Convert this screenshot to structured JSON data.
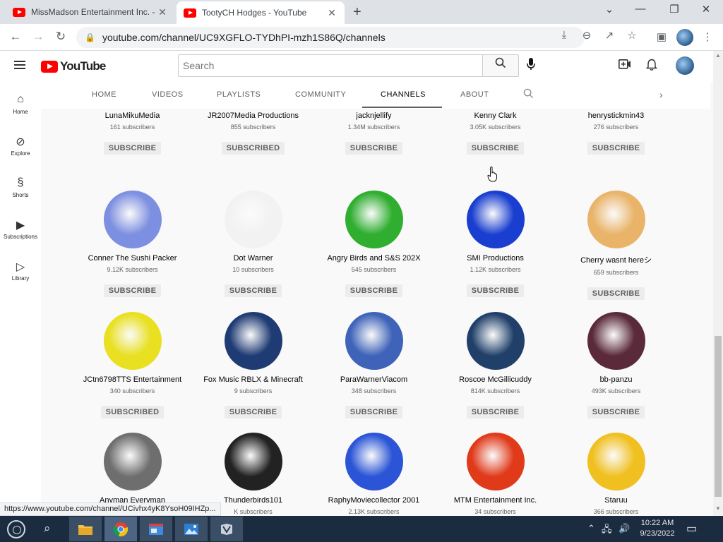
{
  "browser": {
    "tabs": [
      {
        "title": "MissMadson Entertainment Inc. -",
        "active": false
      },
      {
        "title": "TootyCH Hodges - YouTube",
        "active": true
      }
    ],
    "address": "youtube.com/channel/UC9XGFLO-TYDhPI-mzh1S86Q/channels"
  },
  "youtube": {
    "logo_text": "YouTube",
    "search_placeholder": "Search",
    "guide": [
      {
        "label": "Home",
        "icon": "home-icon"
      },
      {
        "label": "Explore",
        "icon": "compass-icon"
      },
      {
        "label": "Shorts",
        "icon": "shorts-icon"
      },
      {
        "label": "Subscriptions",
        "icon": "subscriptions-icon"
      },
      {
        "label": "Library",
        "icon": "library-icon"
      }
    ],
    "channel_tabs": [
      {
        "label": "HOME",
        "active": false
      },
      {
        "label": "VIDEOS",
        "active": false
      },
      {
        "label": "PLAYLISTS",
        "active": false
      },
      {
        "label": "COMMUNITY",
        "active": false
      },
      {
        "label": "CHANNELS",
        "active": true
      },
      {
        "label": "ABOUT",
        "active": false
      }
    ],
    "channels": [
      {
        "name": "LunaMikuMedia",
        "subs": "161 subscribers",
        "button": "SUBSCRIBE",
        "color": "#f7a8d8"
      },
      {
        "name": "JR2007Media Productions",
        "subs": "855 subscribers",
        "button": "SUBSCRIBED",
        "color": "#6a2cf0"
      },
      {
        "name": "jacknjellify",
        "subs": "1.34M subscribers",
        "button": "SUBSCRIBE",
        "color": "#f5c400"
      },
      {
        "name": "Kenny Clark",
        "subs": "3.05K subscribers",
        "button": "SUBSCRIBE",
        "color": "#8b1fd6"
      },
      {
        "name": "henrystickmin43",
        "subs": "276 subscribers",
        "button": "SUBSCRIBE",
        "color": "#c81e1e"
      },
      {
        "name": "Conner The Sushi Packer",
        "subs": "9.12K subscribers",
        "button": "SUBSCRIBE",
        "color": "#7d8fe0"
      },
      {
        "name": "Dot Warner",
        "subs": "10 subscribers",
        "button": "SUBSCRIBE",
        "color": "#f2f2f2"
      },
      {
        "name": "Angry Birds and S&S 202X",
        "subs": "545 subscribers",
        "button": "SUBSCRIBE",
        "color": "#2fae2f"
      },
      {
        "name": "SMI Productions",
        "subs": "1.12K subscribers",
        "button": "SUBSCRIBE",
        "color": "#1a3fd0"
      },
      {
        "name": "Cherry wasnt hereシ",
        "subs": "659 subscribers",
        "button": "SUBSCRIBE",
        "color": "#e9b46a"
      },
      {
        "name": "JCtn6798TTS Entertainment",
        "subs": "340 subscribers",
        "button": "SUBSCRIBED",
        "color": "#e8e020"
      },
      {
        "name": "Fox Music RBLX & Minecraft",
        "subs": "9 subscribers",
        "button": "SUBSCRIBE",
        "color": "#1f3b73"
      },
      {
        "name": "ParaWarnerViacom",
        "subs": "348 subscribers",
        "button": "SUBSCRIBE",
        "color": "#3e63b8"
      },
      {
        "name": "Roscoe McGillicuddy",
        "subs": "814K subscribers",
        "button": "SUBSCRIBE",
        "color": "#20406a"
      },
      {
        "name": "bb-panzu",
        "subs": "493K subscribers",
        "button": "SUBSCRIBE",
        "color": "#5a2a3a"
      },
      {
        "name": "Anyman Everyman",
        "subs": "",
        "button": "",
        "color": "#6e6e6e"
      },
      {
        "name": "Thunderbirds101",
        "subs": "K subscribers",
        "button": "",
        "color": "#222222"
      },
      {
        "name": "RaphyMoviecollector 2001",
        "subs": "2.13K subscribers",
        "button": "",
        "color": "#2b55d6"
      },
      {
        "name": "MTM Entertainment Inc.",
        "subs": "34 subscribers",
        "button": "",
        "color": "#e03a1a"
      },
      {
        "name": "Staruu",
        "subs": "366 subscribers",
        "button": "",
        "color": "#f0c020"
      }
    ]
  },
  "status_url": "https://www.youtube.com/channel/UCivhx4yK8YsoH09IHZp...",
  "taskbar": {
    "time": "10:22 AM",
    "date": "9/23/2022"
  },
  "colors": {
    "brand_red": "#ff0000",
    "taskbar": "#1c2c40"
  }
}
